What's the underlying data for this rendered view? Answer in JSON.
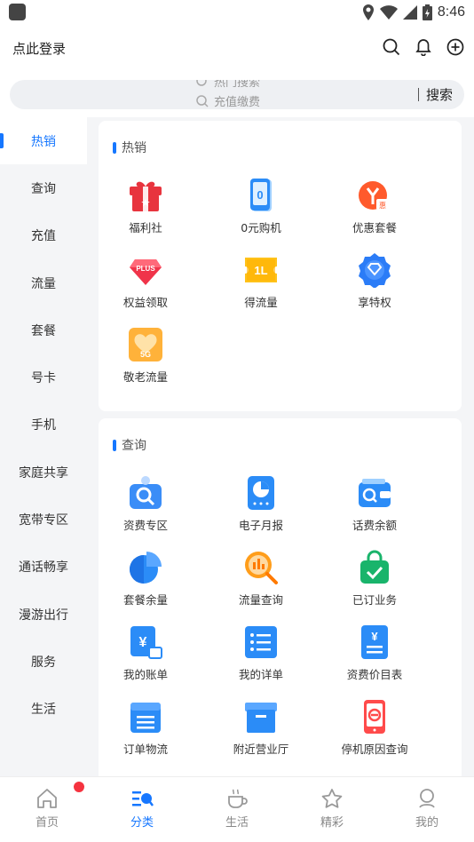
{
  "status_bar": {
    "time": "8:46"
  },
  "header": {
    "login_text": "点此登录"
  },
  "search": {
    "hint_top": "热门搜索",
    "hint_main": "充值缴费",
    "button": "搜索"
  },
  "sidebar": {
    "items": [
      {
        "label": "热销",
        "active": true
      },
      {
        "label": "查询"
      },
      {
        "label": "充值"
      },
      {
        "label": "流量"
      },
      {
        "label": "套餐"
      },
      {
        "label": "号卡"
      },
      {
        "label": "手机"
      },
      {
        "label": "家庭共享"
      },
      {
        "label": "宽带专区"
      },
      {
        "label": "通话畅享"
      },
      {
        "label": "漫游出行"
      },
      {
        "label": "服务"
      },
      {
        "label": "生活"
      }
    ]
  },
  "sections": [
    {
      "title": "热销",
      "items": [
        {
          "label": "福利社",
          "icon": "gift-icon"
        },
        {
          "label": "0元购机",
          "icon": "phone-zero-icon"
        },
        {
          "label": "优惠套餐",
          "icon": "discount-package-icon"
        },
        {
          "label": "权益领取",
          "icon": "plus-diamond-icon"
        },
        {
          "label": "得流量",
          "icon": "data-ticket-icon"
        },
        {
          "label": "享特权",
          "icon": "privilege-badge-icon"
        },
        {
          "label": "敬老流量",
          "icon": "elderly-5g-icon"
        }
      ]
    },
    {
      "title": "查询",
      "items": [
        {
          "label": "资费专区",
          "icon": "tariff-search-icon"
        },
        {
          "label": "电子月报",
          "icon": "monthly-report-icon"
        },
        {
          "label": "话费余额",
          "icon": "balance-wallet-icon"
        },
        {
          "label": "套餐余量",
          "icon": "pie-chart-icon"
        },
        {
          "label": "流量查询",
          "icon": "data-query-icon"
        },
        {
          "label": "已订业务",
          "icon": "subscribed-bag-icon"
        },
        {
          "label": "我的账单",
          "icon": "bill-icon"
        },
        {
          "label": "我的详单",
          "icon": "detail-list-icon"
        },
        {
          "label": "资费价目表",
          "icon": "price-list-icon"
        },
        {
          "label": "订单物流",
          "icon": "order-logistics-icon"
        },
        {
          "label": "附近营业厅",
          "icon": "nearby-hall-icon"
        },
        {
          "label": "停机原因查询",
          "icon": "suspend-reason-icon"
        }
      ]
    }
  ],
  "tabbar": {
    "tabs": [
      {
        "label": "首页",
        "icon": "home-icon"
      },
      {
        "label": "分类",
        "icon": "category-icon",
        "active": true
      },
      {
        "label": "生活",
        "icon": "coffee-icon"
      },
      {
        "label": "精彩",
        "icon": "star-icon"
      },
      {
        "label": "我的",
        "icon": "profile-icon"
      }
    ]
  },
  "colors": {
    "accent": "#1677ff",
    "badge": "#f5333f"
  }
}
